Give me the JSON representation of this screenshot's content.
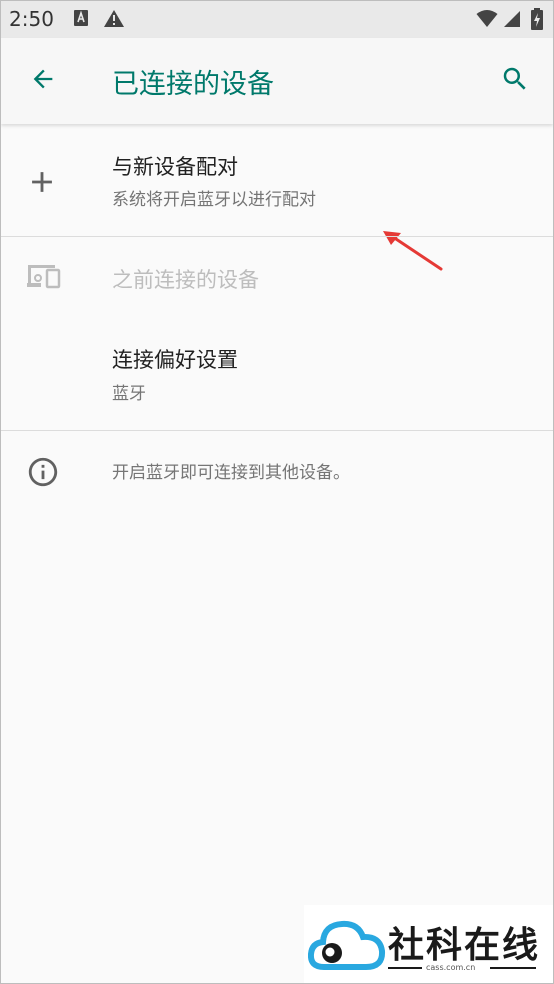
{
  "status_bar": {
    "time": "2:50",
    "icons": [
      "a-box-icon",
      "warning-icon",
      "wifi-icon",
      "signal-icon",
      "battery-icon"
    ]
  },
  "app_bar": {
    "title": "已连接的设备",
    "back_icon": "arrow-back-icon",
    "search_icon": "search-icon",
    "accent": "#00796b"
  },
  "pair_new": {
    "title": "与新设备配对",
    "subtitle": "系统将开启蓝牙以进行配对",
    "icon": "plus-icon"
  },
  "previously_connected": {
    "title": "之前连接的设备",
    "icon": "devices-icon"
  },
  "preferences": {
    "title": "连接偏好设置",
    "subtitle": "蓝牙"
  },
  "info": {
    "text": "开启蓝牙即可连接到其他设备。",
    "icon": "info-icon"
  },
  "watermark": {
    "brand": "社科在线",
    "domain": "cass.com.cn"
  },
  "colors": {
    "annotation_arrow": "#e53935",
    "watermark_cloud": "#29a8e0"
  }
}
